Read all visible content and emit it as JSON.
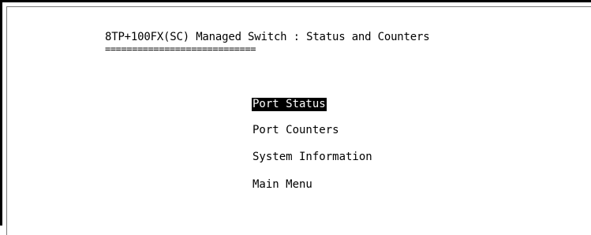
{
  "screen": {
    "title": "8TP+100FX(SC) Managed Switch : Status and Counters",
    "title_underline": "============================"
  },
  "menu": {
    "items": [
      {
        "label": "Port Status",
        "selected": true
      },
      {
        "label": "Port Counters",
        "selected": false
      },
      {
        "label": "System Information",
        "selected": false
      },
      {
        "label": "Main Menu",
        "selected": false
      }
    ]
  },
  "colors": {
    "background": "#ffffff",
    "text": "#000000",
    "highlight_bg": "#000000",
    "highlight_text": "#ffffff"
  }
}
